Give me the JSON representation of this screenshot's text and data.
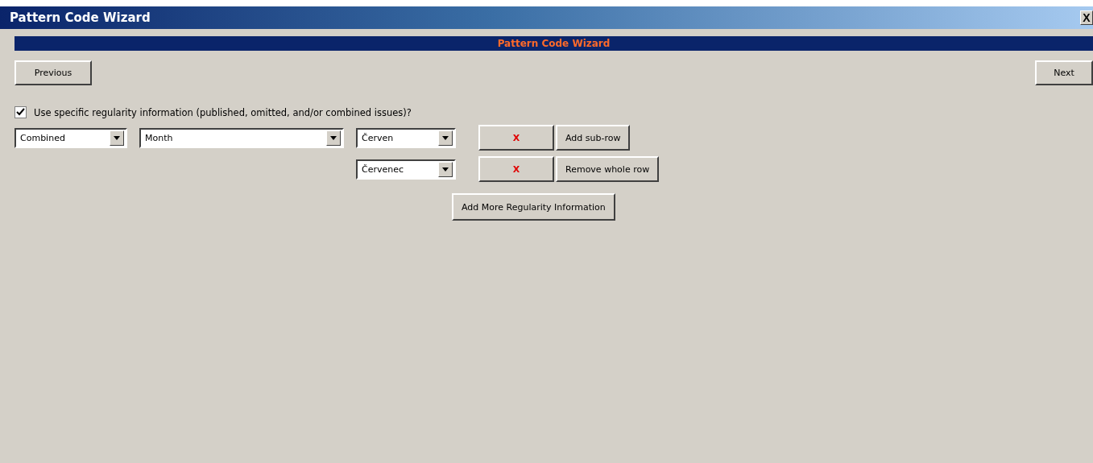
{
  "window": {
    "title": "Pattern Code Wizard",
    "close": "X"
  },
  "header": {
    "title": "Pattern Code Wizard"
  },
  "nav": {
    "previous": "Previous",
    "next": "Next"
  },
  "regularity": {
    "checkbox": {
      "label": "Use specific regularity information (published, omitted, and/or combined issues)?",
      "checked": true
    },
    "rows": [
      {
        "type": "Combined",
        "unit": "Month",
        "subrows": [
          {
            "value": "Červen",
            "remove": "X"
          },
          {
            "value": "Červenec",
            "remove": "X"
          }
        ],
        "add_subrow": "Add sub-row",
        "remove_row": "Remove whole row"
      }
    ],
    "add_more": "Add More Regularity Information"
  }
}
